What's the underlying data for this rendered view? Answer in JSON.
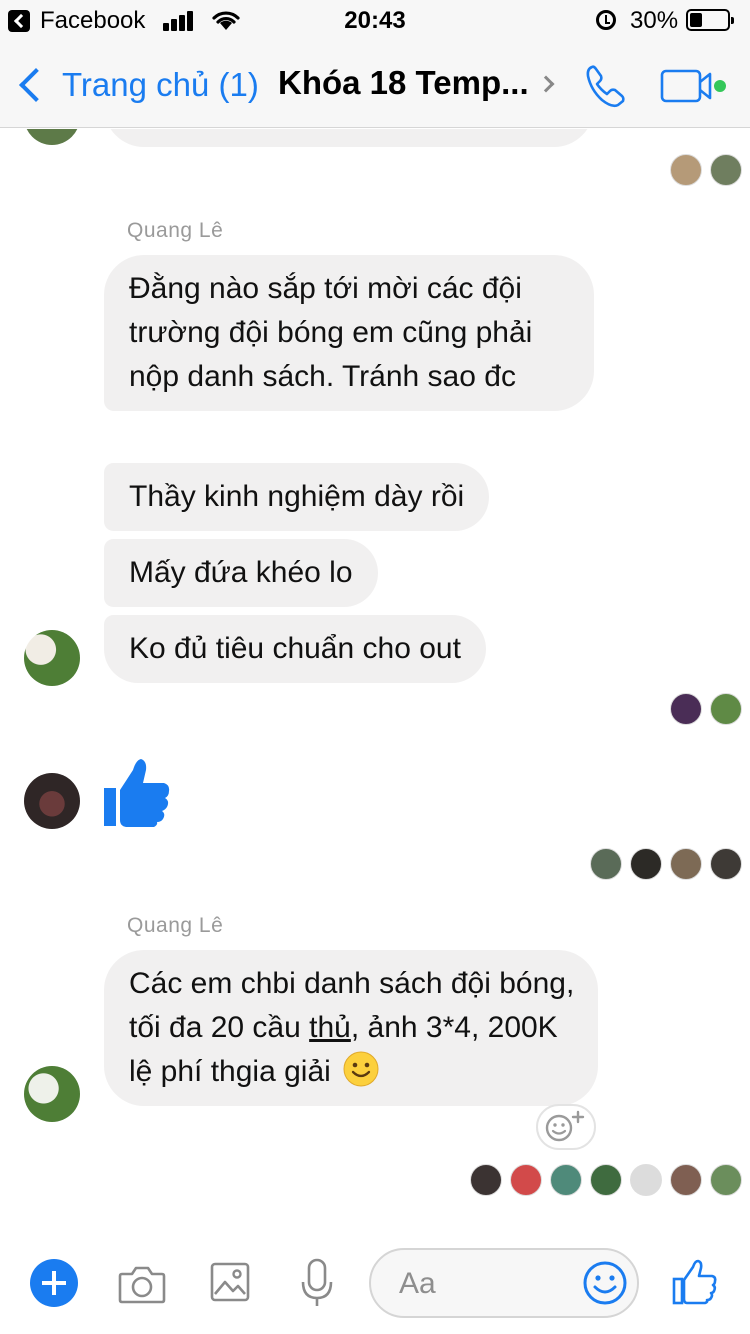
{
  "status_bar": {
    "back_app": "Facebook",
    "time": "20:43",
    "battery": "30%"
  },
  "header": {
    "back_label": "Trang chủ (1)",
    "title": "Khóa 18 Temp..."
  },
  "messages": [
    {
      "sender": "Quang Lê",
      "bubbles": [
        "Đằng nào sắp tới mời các đội trường đội bóng em cũng phải nộp danh sách. Tránh sao đc",
        "Thầy kinh nghiệm dày rồi",
        "Mấy đứa khéo lo",
        "Ko đủ tiêu chuẩn cho out"
      ]
    },
    {
      "sender": "Quang Lê",
      "bubbles": [
        "Các em chbi danh sách đội bóng, tối đa 20 cầu ",
        "thủ",
        ", ảnh 3*4, 200K lệ phí thgia giải"
      ]
    }
  ],
  "composer": {
    "placeholder": "Aa"
  },
  "colors": {
    "accent": "#1a7cf0",
    "bubble_bg": "#f1f0f0",
    "sender_gray": "#9a9a9a"
  },
  "icons": [
    "back-icon",
    "signal-icon",
    "wifi-icon",
    "alarm-icon",
    "battery-icon",
    "phone-icon",
    "video-icon",
    "thumbs-up-icon",
    "camera-icon",
    "image-icon",
    "microphone-icon",
    "emoji-icon",
    "add-reaction-icon",
    "plus-icon"
  ]
}
